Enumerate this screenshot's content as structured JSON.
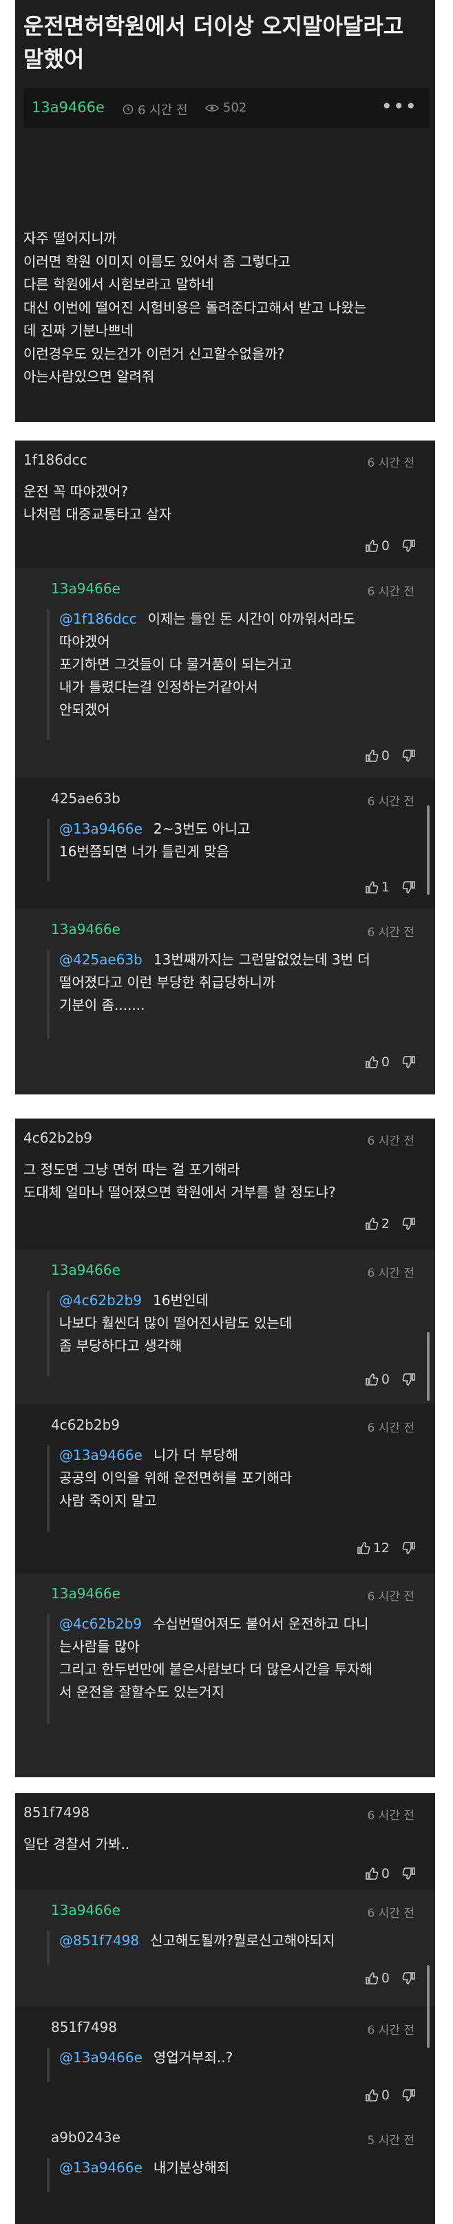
{
  "post": {
    "title": "운전면허학원에서 더이상 오지말아달라고 말했어",
    "author": "13a9466e",
    "time": "6 시간 전",
    "views": "502",
    "body": [
      "자주 떨어지니까",
      "이러면 학원 이미지 이름도 있어서 좀 그렇다고",
      "다른 학원에서 시험보라고 말하네",
      "대신 이번에 떨어진 시험비용은 돌려준다고해서 받고 나왔는",
      "데 진짜 기분나쁘네",
      "이런경우도 있는건가 이런거 신고할수없을까?",
      "아는사람있으면 알려줘"
    ]
  },
  "threads": [
    [
      {
        "author": "1f186dcc",
        "time": "6 시간 전",
        "mention": "",
        "lines": [
          "운전 꼭 따야겠어?",
          "나처럼 대중교통타고 살자"
        ],
        "up": "0",
        "reply": false
      },
      {
        "author": "13a9466e",
        "time": "6 시간 전",
        "mention": "@1f186dcc",
        "lines": [
          "이제는 들인 돈 시간이 아까워서라도",
          "따야겠어",
          "포기하면 그것들이 다 물거품이 되는거고",
          "내가 틀렸다는걸 인정하는거같아서",
          "안되겠어"
        ],
        "up": "0",
        "reply": true
      },
      {
        "author": "425ae63b",
        "time": "6 시간 전",
        "mention": "@13a9466e",
        "lines": [
          "2~3번도 아니고",
          "16번쯤되면 너가 틀린게 맞음"
        ],
        "up": "1",
        "reply": false
      },
      {
        "author": "13a9466e",
        "time": "6 시간 전",
        "mention": "@425ae63b",
        "lines": [
          "13번째까지는 그런말없었는데 3번 더",
          "떨어졌다고 이런 부당한 취급당하니까",
          "기분이 좀......."
        ],
        "up": "0",
        "reply": true
      }
    ],
    [
      {
        "author": "4c62b2b9",
        "time": "6 시간 전",
        "mention": "",
        "lines": [
          "그 정도면 그냥 면허 따는 걸 포기해라",
          "도대체 얼마나 떨어졌으면 학원에서 거부를 할 정도냐?"
        ],
        "up": "2",
        "reply": false
      },
      {
        "author": "13a9466e",
        "time": "6 시간 전",
        "mention": "@4c62b2b9",
        "lines": [
          "16번인데",
          "나보다 훨씬더 많이 떨어진사람도 있는데",
          "좀 부당하다고 생각해"
        ],
        "up": "0",
        "reply": true
      },
      {
        "author": "4c62b2b9",
        "time": "6 시간 전",
        "mention": "@13a9466e",
        "lines": [
          "니가 더 부당해",
          "공공의 이익을 위해 운전면허를 포기해라",
          "사람 죽이지 말고"
        ],
        "up": "12",
        "reply": false
      },
      {
        "author": "13a9466e",
        "time": "6 시간 전",
        "mention": "@4c62b2b9",
        "lines": [
          "수십번떨어져도 붙어서 운전하고 다니",
          "는사람들 많아",
          "그리고 한두번만에 붙은사람보다 더 많은시간을 투자해",
          "서 운전을 잘할수도 있는거지"
        ],
        "up": "",
        "reply": true
      }
    ],
    [
      {
        "author": "851f7498",
        "time": "6 시간 전",
        "mention": "",
        "lines": [
          "일단 경찰서 가봐.."
        ],
        "up": "0",
        "reply": false
      },
      {
        "author": "13a9466e",
        "time": "6 시간 전",
        "mention": "@851f7498",
        "lines": [
          "신고해도될까?뭘로신고해야되지"
        ],
        "up": "0",
        "reply": true
      },
      {
        "author": "851f7498",
        "time": "6 시간 전",
        "mention": "@13a9466e",
        "lines": [
          "영업거부죄..?"
        ],
        "up": "0",
        "reply": false
      },
      {
        "author": "a9b0243e",
        "time": "5 시간 전",
        "mention": "@13a9466e",
        "lines": [
          "내기분상해죄"
        ],
        "up": "",
        "reply": false
      }
    ]
  ]
}
